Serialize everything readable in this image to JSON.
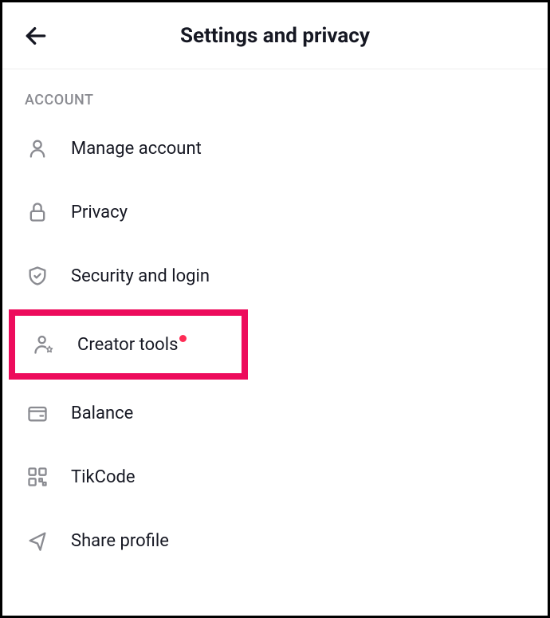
{
  "header": {
    "title": "Settings and privacy"
  },
  "section": {
    "label": "ACCOUNT"
  },
  "menu": {
    "items": [
      {
        "label": "Manage account"
      },
      {
        "label": "Privacy"
      },
      {
        "label": "Security and login"
      },
      {
        "label": "Creator tools"
      },
      {
        "label": "Balance"
      },
      {
        "label": "TikCode"
      },
      {
        "label": "Share profile"
      }
    ]
  }
}
